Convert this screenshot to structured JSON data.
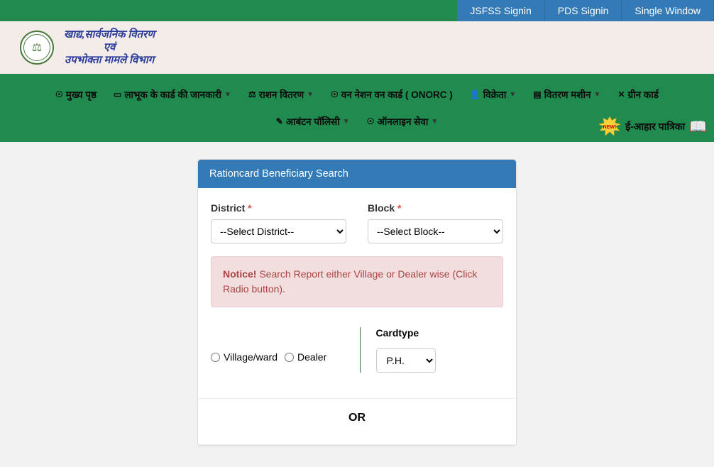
{
  "topbar": {
    "jsfss": "JSFSS Signin",
    "pds": "PDS Signin",
    "single": "Single Window"
  },
  "dept": {
    "line1": "खाद्य,सार्वजनिक वितरण",
    "line2": "एवं",
    "line3": "उपभोक्ता मामले विभाग"
  },
  "nav": {
    "home": "मुख्य पृष्ठ",
    "cardinfo": "लाभूक के कार्ड की जानकारी",
    "ration": "राशन वितरण",
    "onorc": "वन नेशन वन कार्ड ( ONORC )",
    "vendor": "विक्रेता",
    "machine": "वितरण मशीन",
    "green": "ग्रीन कार्ड",
    "policy": "आबंटन पॉलिसी",
    "online": "ऑनलाइन सेवा",
    "ehaar": "ई-आहार पात्रिका"
  },
  "panel": {
    "title": "Rationcard Beneficiary Search",
    "district_label": "District",
    "block_label": "Block",
    "district_placeholder": "--Select District--",
    "block_placeholder": "--Select Block--",
    "notice_bold": "Notice!",
    "notice_text": " Search Report either Village or Dealer wise (Click Radio button).",
    "radio_village": "Village/ward",
    "radio_dealer": "Dealer",
    "cardtype_label": "Cardtype",
    "cardtype_value": "P.H.",
    "or_label": "OR"
  }
}
